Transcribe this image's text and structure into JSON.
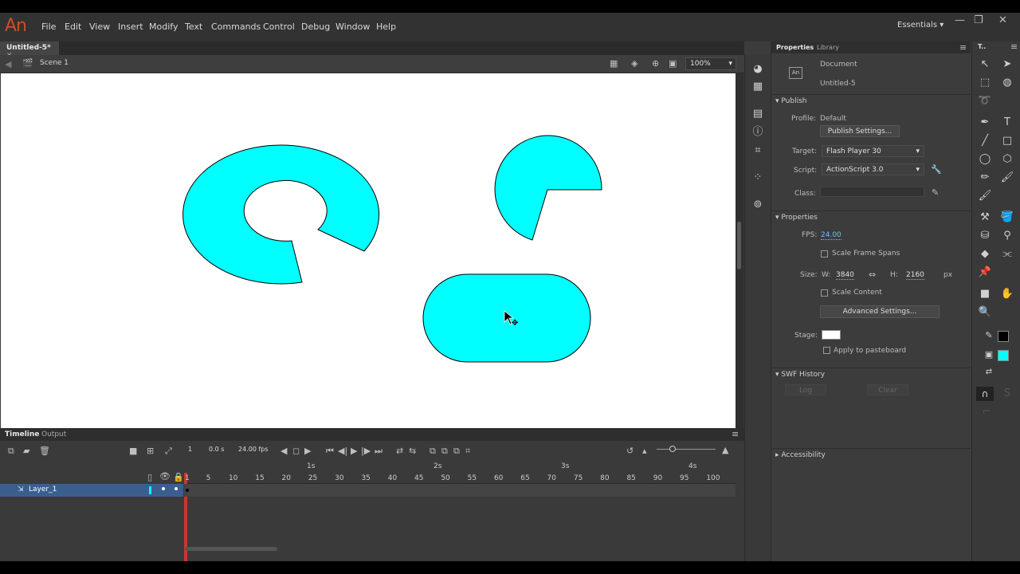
{
  "app": {
    "logo": "An",
    "menu": [
      "File",
      "Edit",
      "View",
      "Insert",
      "Modify",
      "Text",
      "Commands",
      "Control",
      "Debug",
      "Window",
      "Help"
    ],
    "workspace": "Essentials",
    "window_controls": {
      "minimize": "—",
      "maximize": "❐",
      "close": "✕"
    }
  },
  "document": {
    "tab_label": "Untitled-5*",
    "scene": "Scene 1",
    "zoom": "100%"
  },
  "stage": {
    "fill_color": "#00ffff",
    "stroke_color": "#000000",
    "background": "#ffffff"
  },
  "timeline": {
    "tabs": [
      "Timeline",
      "Output"
    ],
    "current_frame": "1",
    "time": "0.0",
    "time_unit": "s",
    "fps": "24.00",
    "fps_unit": "fps",
    "seconds_labels": [
      "1s",
      "2s",
      "3s",
      "4s"
    ],
    "frame_numbers": [
      "1",
      "5",
      "10",
      "15",
      "20",
      "25",
      "30",
      "35",
      "40",
      "45",
      "50",
      "55",
      "60",
      "65",
      "70",
      "75",
      "80",
      "85",
      "90",
      "95",
      "100"
    ],
    "layer_name": "Layer_1"
  },
  "properties": {
    "tabs": [
      "Properties",
      "Library"
    ],
    "doc_type": "Document",
    "doc_name": "Untitled-5",
    "doc_icon": "An",
    "publish": {
      "section": "Publish",
      "profile_label": "Profile:",
      "profile_value": "Default",
      "publish_settings_btn": "Publish Settings...",
      "target_label": "Target:",
      "target_value": "Flash Player 30",
      "script_label": "Script:",
      "script_value": "ActionScript 3.0",
      "class_label": "Class:"
    },
    "props": {
      "section": "Properties",
      "fps_label": "FPS:",
      "fps_value": "24.00",
      "scale_frame_spans": "Scale Frame Spans",
      "size_label": "Size:",
      "w_label": "W:",
      "w_value": "3840",
      "h_label": "H:",
      "h_value": "2160",
      "unit": "px",
      "scale_content": "Scale Content",
      "advanced_btn": "Advanced Settings...",
      "stage_label": "Stage:",
      "stage_color": "#ffffff",
      "apply_pasteboard": "Apply to pasteboard"
    },
    "swf": {
      "section": "SWF History",
      "log_btn": "Log",
      "clear_btn": "Clear"
    },
    "accessibility": "Accessibility"
  },
  "tools": {
    "header": "T..",
    "stroke_color": "#000000",
    "fill_color": "#00ffff"
  }
}
